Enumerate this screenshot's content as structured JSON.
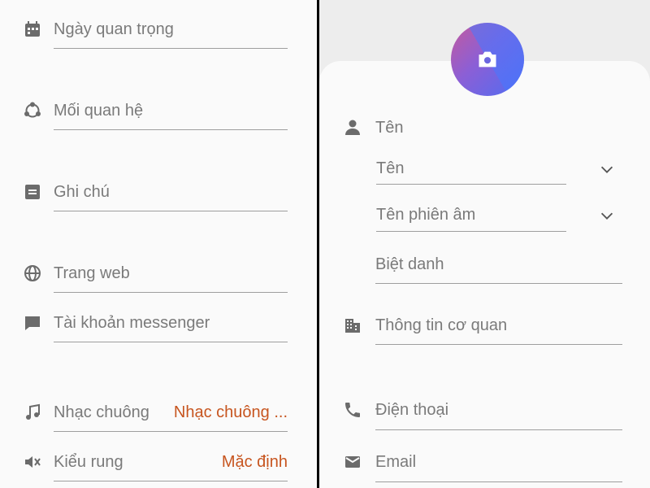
{
  "left": {
    "fields": [
      {
        "label": "Ngày quan trọng",
        "icon": "calendar-icon"
      },
      {
        "label": "Mối quan hệ",
        "icon": "relationship-icon"
      },
      {
        "label": "Ghi chú",
        "icon": "note-icon"
      },
      {
        "label": "Trang web",
        "icon": "globe-icon"
      },
      {
        "label": "Tài khoản messenger",
        "icon": "chat-icon"
      },
      {
        "label": "Nhạc chuông",
        "value": "Nhạc chuông ...",
        "icon": "music-note-icon"
      },
      {
        "label": "Kiểu rung",
        "value": "Mặc định",
        "icon": "vibrate-icon"
      }
    ]
  },
  "right": {
    "name_header": "Tên",
    "name_field": "Tên",
    "phonetic_field": "Tên phiên âm",
    "nickname_field": "Biệt danh",
    "organization_field": "Thông tin cơ quan",
    "phone_field": "Điện thoại",
    "email_field": "Email"
  },
  "colors": {
    "accent": "#c7551f",
    "label": "#7a7a7a",
    "icon": "#6b6b6b"
  }
}
